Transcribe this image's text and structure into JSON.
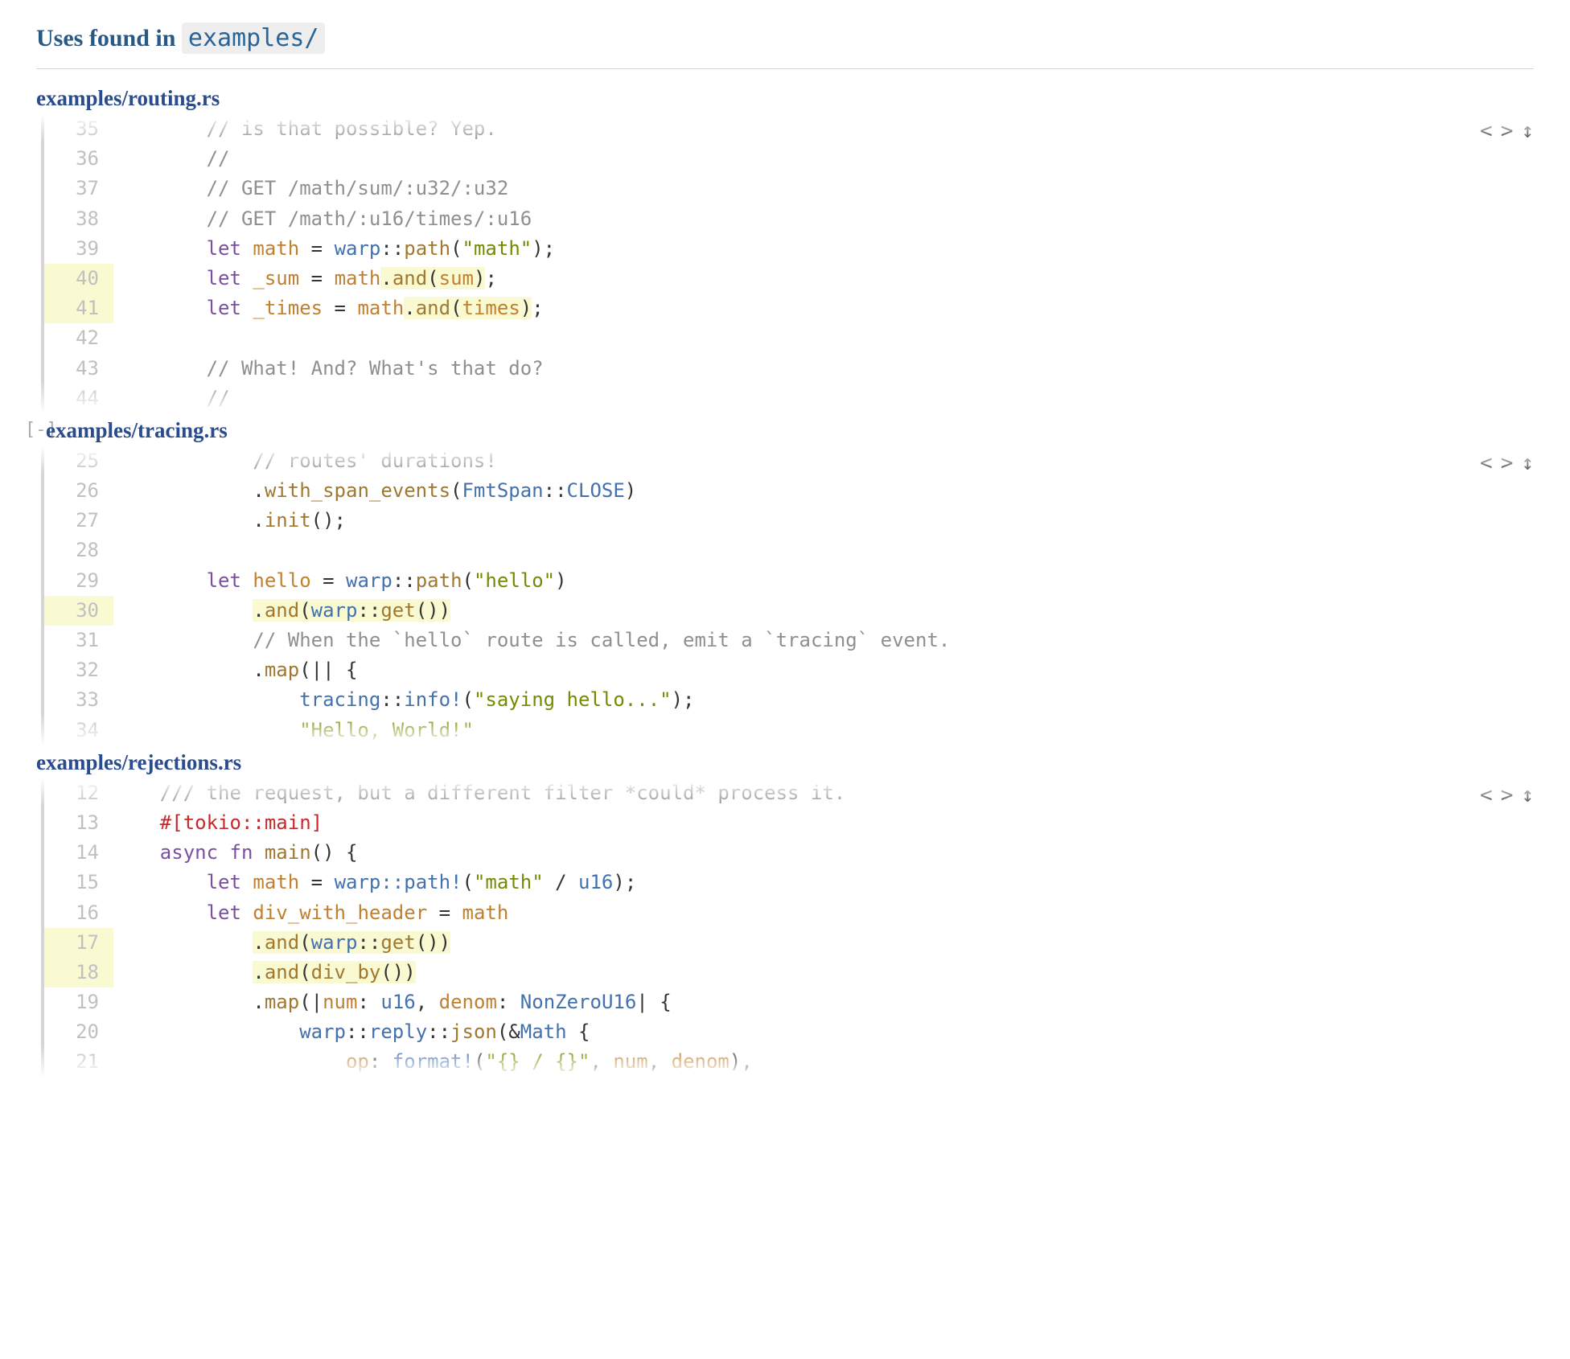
{
  "header": {
    "prefix": "Uses found in ",
    "path": "examples/"
  },
  "icons": {
    "prev": "<",
    "next": ">",
    "updown": "↕",
    "collapse": "[-]"
  },
  "files": [
    {
      "title": "examples/routing.rs",
      "collapsible": false,
      "fadeTop": true,
      "fadeBottom": true,
      "lines": [
        {
          "n": 35,
          "hl": false,
          "tokens": [
            [
              "",
              "        "
            ],
            [
              "comment",
              "// is that possible? Yep."
            ]
          ]
        },
        {
          "n": 36,
          "hl": false,
          "tokens": [
            [
              "",
              "        "
            ],
            [
              "comment",
              "//"
            ]
          ]
        },
        {
          "n": 37,
          "hl": false,
          "tokens": [
            [
              "",
              "        "
            ],
            [
              "comment",
              "// GET /math/sum/:u32/:u32"
            ]
          ]
        },
        {
          "n": 38,
          "hl": false,
          "tokens": [
            [
              "",
              "        "
            ],
            [
              "comment",
              "// GET /math/:u16/times/:u16"
            ]
          ]
        },
        {
          "n": 39,
          "hl": false,
          "tokens": [
            [
              "",
              "        "
            ],
            [
              "kw",
              "let"
            ],
            [
              "",
              " "
            ],
            [
              "ident",
              "math"
            ],
            [
              "",
              " = "
            ],
            [
              "type",
              "warp"
            ],
            [
              "",
              "::"
            ],
            [
              "fn",
              "path"
            ],
            [
              "",
              "("
            ],
            [
              "str",
              "\"math\""
            ],
            [
              "",
              ");"
            ]
          ]
        },
        {
          "n": 40,
          "hl": true,
          "tokens": [
            [
              "",
              "        "
            ],
            [
              "kw",
              "let"
            ],
            [
              "",
              " "
            ],
            [
              "ident",
              "_sum"
            ],
            [
              "",
              " = "
            ],
            [
              "ident",
              "math"
            ],
            [
              "hl-open",
              ""
            ],
            [
              "",
              "."
            ],
            [
              "fn",
              "and"
            ],
            [
              "",
              "("
            ],
            [
              "ident",
              "sum"
            ],
            [
              "",
              ")"
            ],
            [
              "hl-close",
              ""
            ],
            [
              "",
              ";"
            ]
          ]
        },
        {
          "n": 41,
          "hl": true,
          "tokens": [
            [
              "",
              "        "
            ],
            [
              "kw",
              "let"
            ],
            [
              "",
              " "
            ],
            [
              "ident",
              "_times"
            ],
            [
              "",
              " = "
            ],
            [
              "ident",
              "math"
            ],
            [
              "hl-open",
              ""
            ],
            [
              "",
              "."
            ],
            [
              "fn",
              "and"
            ],
            [
              "",
              "("
            ],
            [
              "ident",
              "times"
            ],
            [
              "",
              ")"
            ],
            [
              "hl-close",
              ""
            ],
            [
              "",
              ";"
            ]
          ]
        },
        {
          "n": 42,
          "hl": false,
          "tokens": [
            [
              "",
              ""
            ]
          ]
        },
        {
          "n": 43,
          "hl": false,
          "tokens": [
            [
              "",
              "        "
            ],
            [
              "comment",
              "// What! And? What's that do?"
            ]
          ]
        },
        {
          "n": 44,
          "hl": false,
          "tokens": [
            [
              "",
              "        "
            ],
            [
              "comment",
              "//"
            ]
          ]
        }
      ]
    },
    {
      "title": "examples/tracing.rs",
      "collapsible": true,
      "fadeTop": true,
      "fadeBottom": true,
      "lines": [
        {
          "n": 25,
          "hl": false,
          "tokens": [
            [
              "",
              "            "
            ],
            [
              "comment",
              "// routes' durations!"
            ]
          ]
        },
        {
          "n": 26,
          "hl": false,
          "tokens": [
            [
              "",
              "            ."
            ],
            [
              "fn",
              "with_span_events"
            ],
            [
              "",
              "("
            ],
            [
              "type",
              "FmtSpan"
            ],
            [
              "",
              "::"
            ],
            [
              "type",
              "CLOSE"
            ],
            [
              "",
              ")"
            ]
          ]
        },
        {
          "n": 27,
          "hl": false,
          "tokens": [
            [
              "",
              "            ."
            ],
            [
              "fn",
              "init"
            ],
            [
              "",
              "();"
            ]
          ]
        },
        {
          "n": 28,
          "hl": false,
          "tokens": [
            [
              "",
              ""
            ]
          ]
        },
        {
          "n": 29,
          "hl": false,
          "tokens": [
            [
              "",
              "        "
            ],
            [
              "kw",
              "let"
            ],
            [
              "",
              " "
            ],
            [
              "ident",
              "hello"
            ],
            [
              "",
              " = "
            ],
            [
              "type",
              "warp"
            ],
            [
              "",
              "::"
            ],
            [
              "fn",
              "path"
            ],
            [
              "",
              "("
            ],
            [
              "str",
              "\"hello\""
            ],
            [
              "",
              ")"
            ]
          ]
        },
        {
          "n": 30,
          "hl": true,
          "tokens": [
            [
              "",
              "            "
            ],
            [
              "hl-open",
              ""
            ],
            [
              "",
              "."
            ],
            [
              "fn",
              "and"
            ],
            [
              "",
              "("
            ],
            [
              "type",
              "warp"
            ],
            [
              "",
              "::"
            ],
            [
              "fn",
              "get"
            ],
            [
              "",
              "())"
            ],
            [
              "hl-close",
              ""
            ]
          ]
        },
        {
          "n": 31,
          "hl": false,
          "tokens": [
            [
              "",
              "            "
            ],
            [
              "comment",
              "// When the `hello` route is called, emit a `tracing` event."
            ]
          ]
        },
        {
          "n": 32,
          "hl": false,
          "tokens": [
            [
              "",
              "            ."
            ],
            [
              "fn",
              "map"
            ],
            [
              "",
              "(|| {"
            ]
          ]
        },
        {
          "n": 33,
          "hl": false,
          "tokens": [
            [
              "",
              "                "
            ],
            [
              "type",
              "tracing"
            ],
            [
              "",
              "::"
            ],
            [
              "macro",
              "info!"
            ],
            [
              "",
              "("
            ],
            [
              "str",
              "\"saying hello...\""
            ],
            [
              "",
              ");"
            ]
          ]
        },
        {
          "n": 34,
          "hl": false,
          "tokens": [
            [
              "",
              "                "
            ],
            [
              "str",
              "\"Hello, World!\""
            ]
          ]
        }
      ]
    },
    {
      "title": "examples/rejections.rs",
      "collapsible": false,
      "fadeTop": true,
      "fadeBottom": true,
      "lines": [
        {
          "n": 12,
          "hl": false,
          "tokens": [
            [
              "",
              "    "
            ],
            [
              "comment",
              "/// the request, but a different filter *could* process it."
            ]
          ]
        },
        {
          "n": 13,
          "hl": false,
          "tokens": [
            [
              "",
              "    "
            ],
            [
              "attr",
              "#[tokio::main]"
            ]
          ]
        },
        {
          "n": 14,
          "hl": false,
          "tokens": [
            [
              "",
              "    "
            ],
            [
              "kw",
              "async"
            ],
            [
              "",
              " "
            ],
            [
              "kw",
              "fn"
            ],
            [
              "",
              " "
            ],
            [
              "fn",
              "main"
            ],
            [
              "",
              "() {"
            ]
          ]
        },
        {
          "n": 15,
          "hl": false,
          "tokens": [
            [
              "",
              "        "
            ],
            [
              "kw",
              "let"
            ],
            [
              "",
              " "
            ],
            [
              "ident",
              "math"
            ],
            [
              "",
              " = "
            ],
            [
              "macro",
              "warp::path!"
            ],
            [
              "",
              "("
            ],
            [
              "str",
              "\"math\""
            ],
            [
              "",
              " / "
            ],
            [
              "type",
              "u16"
            ],
            [
              "",
              ");"
            ]
          ]
        },
        {
          "n": 16,
          "hl": false,
          "tokens": [
            [
              "",
              "        "
            ],
            [
              "kw",
              "let"
            ],
            [
              "",
              " "
            ],
            [
              "ident",
              "div_with_header"
            ],
            [
              "",
              " = "
            ],
            [
              "ident",
              "math"
            ]
          ]
        },
        {
          "n": 17,
          "hl": true,
          "tokens": [
            [
              "",
              "            "
            ],
            [
              "hl-open",
              ""
            ],
            [
              "",
              "."
            ],
            [
              "fn",
              "and"
            ],
            [
              "",
              "("
            ],
            [
              "type",
              "warp"
            ],
            [
              "",
              "::"
            ],
            [
              "fn",
              "get"
            ],
            [
              "",
              "())"
            ],
            [
              "hl-close",
              ""
            ]
          ]
        },
        {
          "n": 18,
          "hl": true,
          "tokens": [
            [
              "",
              "            "
            ],
            [
              "hl-open",
              ""
            ],
            [
              "",
              "."
            ],
            [
              "fn",
              "and"
            ],
            [
              "",
              "("
            ],
            [
              "fn",
              "div_by"
            ],
            [
              "",
              "())"
            ],
            [
              "hl-close",
              ""
            ]
          ]
        },
        {
          "n": 19,
          "hl": false,
          "tokens": [
            [
              "",
              "            ."
            ],
            [
              "fn",
              "map"
            ],
            [
              "",
              "(|"
            ],
            [
              "ident",
              "num"
            ],
            [
              "",
              ": "
            ],
            [
              "type",
              "u16"
            ],
            [
              "",
              ", "
            ],
            [
              "ident",
              "denom"
            ],
            [
              "",
              ": "
            ],
            [
              "type",
              "NonZeroU16"
            ],
            [
              "",
              "| {"
            ]
          ]
        },
        {
          "n": 20,
          "hl": false,
          "tokens": [
            [
              "",
              "                "
            ],
            [
              "type",
              "warp"
            ],
            [
              "",
              "::"
            ],
            [
              "type",
              "reply"
            ],
            [
              "",
              "::"
            ],
            [
              "fn",
              "json"
            ],
            [
              "",
              "(&"
            ],
            [
              "type",
              "Math"
            ],
            [
              "",
              " {"
            ]
          ]
        },
        {
          "n": 21,
          "hl": false,
          "tokens": [
            [
              "",
              "                    "
            ],
            [
              "ident",
              "op"
            ],
            [
              "",
              ": "
            ],
            [
              "macro",
              "format!"
            ],
            [
              "",
              "("
            ],
            [
              "str",
              "\"{} / {}\""
            ],
            [
              "",
              ", "
            ],
            [
              "ident",
              "num"
            ],
            [
              "",
              ", "
            ],
            [
              "ident",
              "denom"
            ],
            [
              "",
              "),"
            ]
          ]
        }
      ]
    }
  ]
}
